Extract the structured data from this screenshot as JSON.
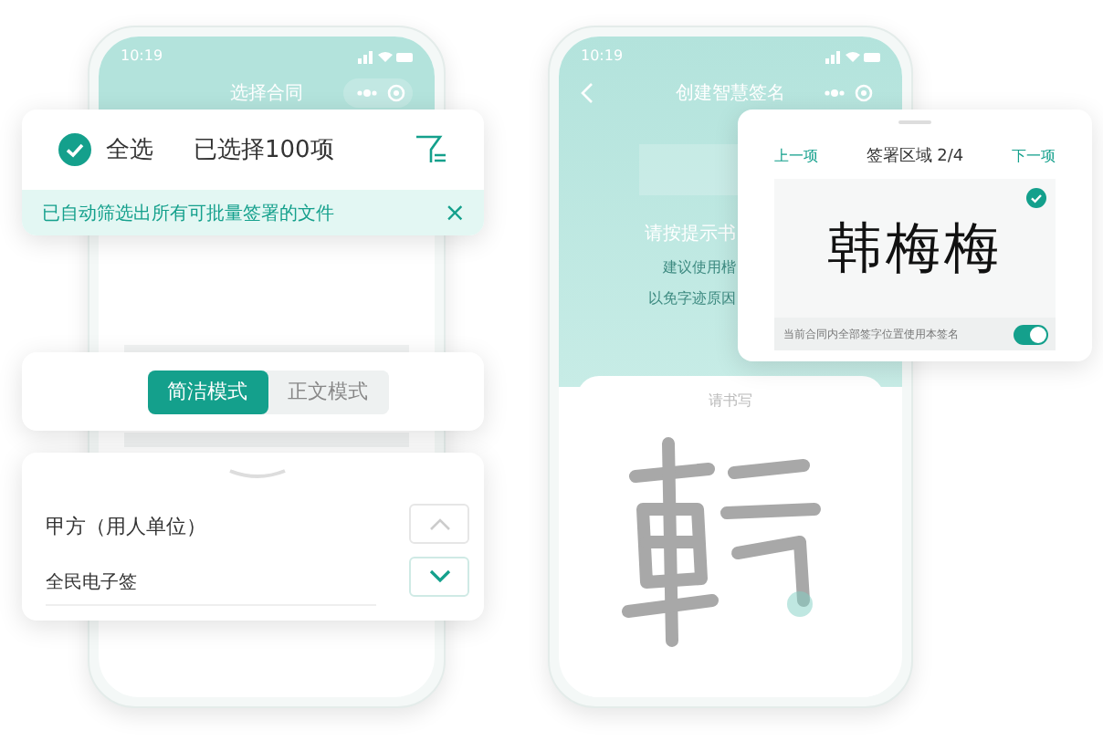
{
  "left_phone": {
    "time": "10:19",
    "title": "选择合同"
  },
  "select_card": {
    "select_all": {
      "label": "全选",
      "checked": true
    },
    "count": "已选择100项",
    "notice": "已自动筛选出所有可批量签署的文件",
    "close": "×"
  },
  "mode_tabs": [
    {
      "label": "简洁模式",
      "selected": true
    },
    {
      "label": "正文模式",
      "selected": false
    }
  ],
  "party_card": {
    "label": "甲方（用人单位）",
    "value": "全民电子签"
  },
  "right_phone": {
    "time": "10:19",
    "title": "创建智慧签名",
    "prompt": "请按提示书",
    "hint_lines": [
      "建议使用楷",
      "以免字迹原因"
    ],
    "write_label": "请书写"
  },
  "signature_card": {
    "prev": "上一项",
    "title": "签署区域 2/4",
    "next": "下一项",
    "signature": "韩梅梅",
    "apply_all": {
      "label": "当前合同内全部签字位置使用本签名",
      "on": true
    }
  }
}
